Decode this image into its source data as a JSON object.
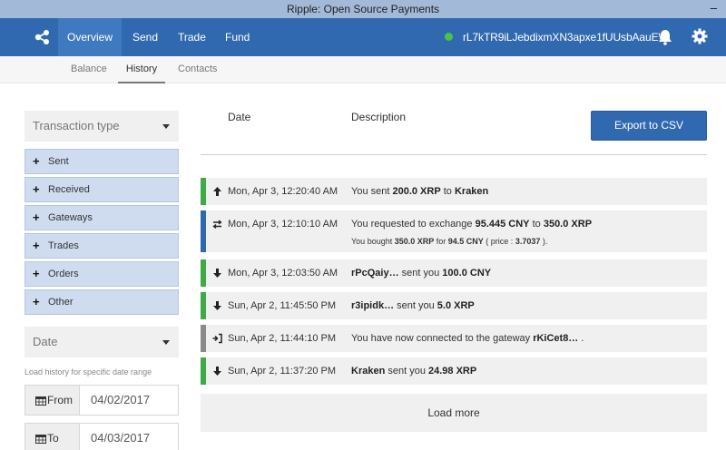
{
  "window": {
    "title": "Ripple: Open Source Payments",
    "minimize": "–"
  },
  "nav": {
    "logo_icon": "ripple-logo-icon",
    "items": [
      {
        "label": "Overview",
        "active": true
      },
      {
        "label": "Send",
        "active": false
      },
      {
        "label": "Trade",
        "active": false
      },
      {
        "label": "Fund",
        "active": false
      }
    ],
    "account": "rL7kTR9iLJebdixmXN3apxe1fUUsbAauEW",
    "status_color": "#4cc348",
    "bell_icon": "bell-icon",
    "settings_icon": "gear-icon"
  },
  "subnav": {
    "items": [
      {
        "label": "Balance",
        "active": false
      },
      {
        "label": "History",
        "active": true
      },
      {
        "label": "Contacts",
        "active": false
      }
    ]
  },
  "filters": {
    "type_header": "Transaction type",
    "types": [
      "Sent",
      "Received",
      "Gateways",
      "Trades",
      "Orders",
      "Other"
    ],
    "date_header": "Date",
    "date_help": "Load history for specific date range",
    "from_label": "From",
    "from_value": "04/02/2017",
    "to_label": "To",
    "to_value": "04/03/2017"
  },
  "table": {
    "date_header": "Date",
    "description_header": "Description",
    "export_label": "Export to CSV",
    "load_more": "Load more",
    "rows": [
      {
        "kind": "sent",
        "icon": "arrow-up-icon",
        "color": "#3eab47",
        "date": "Mon, Apr 3, 12:20:40 AM",
        "d1": "You sent ",
        "d2": "200.0 XRP",
        "d3": " to ",
        "d4": "Kraken",
        "d5": ""
      },
      {
        "kind": "exchange",
        "icon": "exchange-arrows-icon",
        "color": "#3169b0",
        "date": "Mon, Apr 3, 12:10:10 AM",
        "d1": "You requested to exchange ",
        "d2": "95.445 CNY",
        "d3": " to ",
        "d4": "350.0 XRP",
        "d5": "",
        "detail1": "You bought ",
        "detail2": "350.0 XRP",
        "detail3": " for ",
        "detail4": "94.5 CNY",
        "detail5": " ( price : ",
        "detail6": "3.7037",
        "detail7": " )."
      },
      {
        "kind": "received",
        "icon": "arrow-down-icon",
        "color": "#3eab47",
        "date": "Mon, Apr 3, 12:03:50 AM",
        "d1": "",
        "d2": "rPcQaiy…",
        "d3": " sent you ",
        "d4": "100.0 CNY",
        "d5": ""
      },
      {
        "kind": "received",
        "icon": "arrow-down-icon",
        "color": "#3eab47",
        "date": "Sun, Apr 2, 11:45:50 PM",
        "d1": "",
        "d2": "r3ipidk…",
        "d3": " sent you ",
        "d4": "5.0 XRP",
        "d5": ""
      },
      {
        "kind": "gateway",
        "icon": "sign-in-icon",
        "color": "#8a8a8a",
        "date": "Sun, Apr 2, 11:44:10 PM",
        "d1": "You have now connected to the gateway ",
        "d2": "rKiCet8…",
        "d3": " .",
        "d4": "",
        "d5": ""
      },
      {
        "kind": "received",
        "icon": "arrow-down-icon",
        "color": "#3eab47",
        "date": "Sun, Apr 2, 11:37:20 PM",
        "d1": "",
        "d2": "Kraken",
        "d3": " sent you ",
        "d4": "24.98 XRP",
        "d5": ""
      }
    ]
  }
}
